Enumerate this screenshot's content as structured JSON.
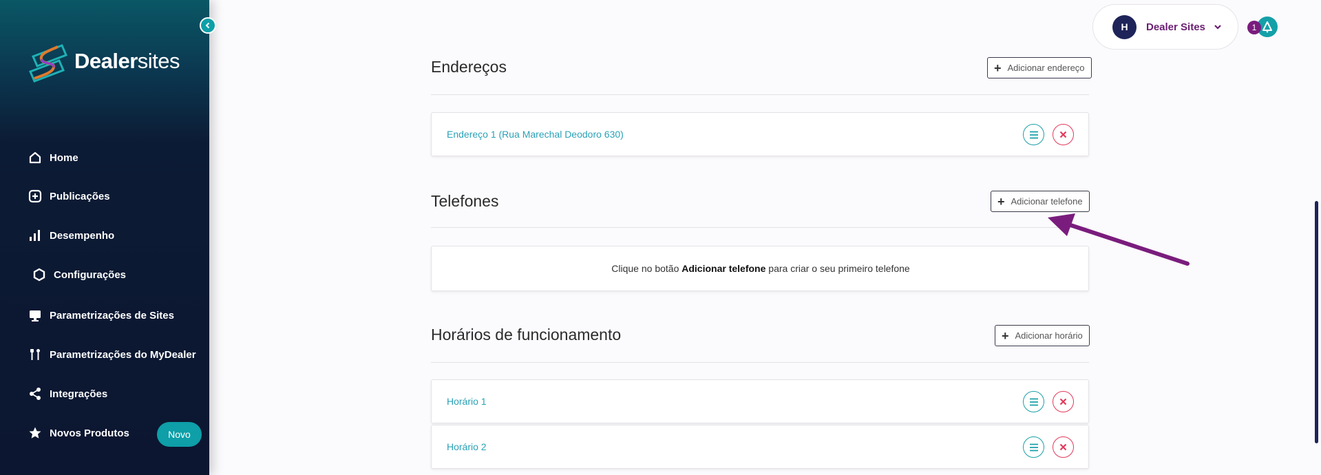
{
  "sidebar": {
    "logo_bold": "Dealer",
    "logo_regular": "sites",
    "items": [
      {
        "label": "Home",
        "icon": "home-icon"
      },
      {
        "label": "Publicações",
        "icon": "plus-square-icon"
      },
      {
        "label": "Desempenho",
        "icon": "bar-chart-icon"
      },
      {
        "label": "Configurações",
        "icon": "hexagon-icon"
      },
      {
        "label": "Parametrizações de Sites",
        "icon": "monitor-icon"
      },
      {
        "label": "Parametrizações do MyDealer",
        "icon": "tools-icon"
      },
      {
        "label": "Integrações",
        "icon": "share-icon"
      },
      {
        "label": "Novos Produtos",
        "icon": "star-icon"
      }
    ],
    "new_badge": "Novo"
  },
  "header": {
    "avatar_initial": "H",
    "user_name": "Dealer Sites",
    "notification_count": "1"
  },
  "sections": {
    "addresses": {
      "title": "Endereços",
      "add_label": "Adicionar endereço",
      "items": [
        "Endereço 1 (Rua Marechal Deodoro 630)"
      ]
    },
    "phones": {
      "title": "Telefones",
      "add_label": "Adicionar telefone",
      "empty_prefix": "Clique no botão ",
      "empty_bold": "Adicionar telefone",
      "empty_suffix": " para criar o seu primeiro telefone"
    },
    "hours": {
      "title": "Horários de funcionamento",
      "add_label": "Adicionar horário",
      "items": [
        "Horário 1",
        "Horário 2"
      ]
    }
  },
  "colors": {
    "accent": "#0e9fa8",
    "brand_purple": "#7a1c7d",
    "danger": "#e23a5b",
    "link": "#2aa2b7",
    "arrow": "#7a1c7d"
  }
}
